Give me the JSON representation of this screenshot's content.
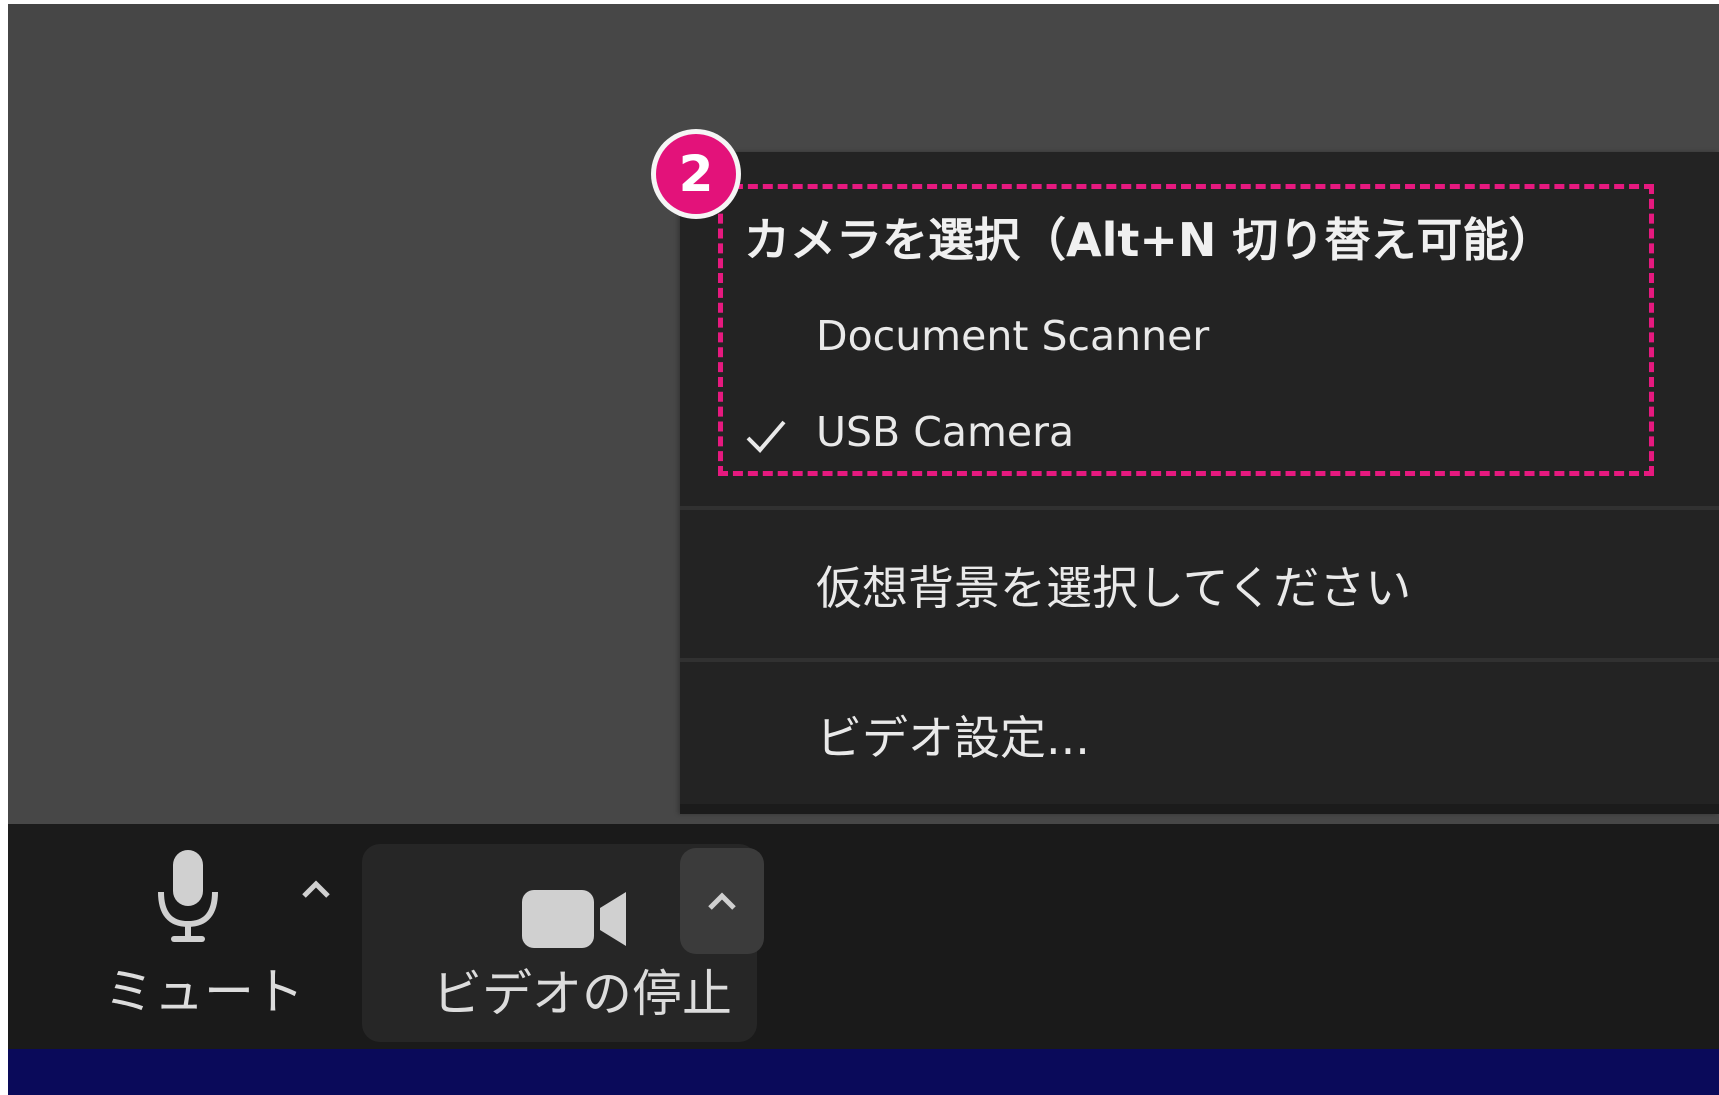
{
  "menu": {
    "camera_header": "カメラを選択（Alt+N 切り替え可能）",
    "cameras": [
      {
        "label": "Document Scanner",
        "selected": false
      },
      {
        "label": "USB Camera",
        "selected": true
      }
    ],
    "virtual_background": "仮想背景を選択してください",
    "video_settings": "ビデオ設定..."
  },
  "annotation": {
    "badge_number": "2",
    "highlight_color": "#e6197f"
  },
  "toolbar": {
    "mute_label": "ミュート",
    "video_label": "ビデオの停止"
  },
  "icons": [
    "microphone-icon",
    "caret-up-icon",
    "video-camera-icon",
    "checkmark-icon"
  ]
}
